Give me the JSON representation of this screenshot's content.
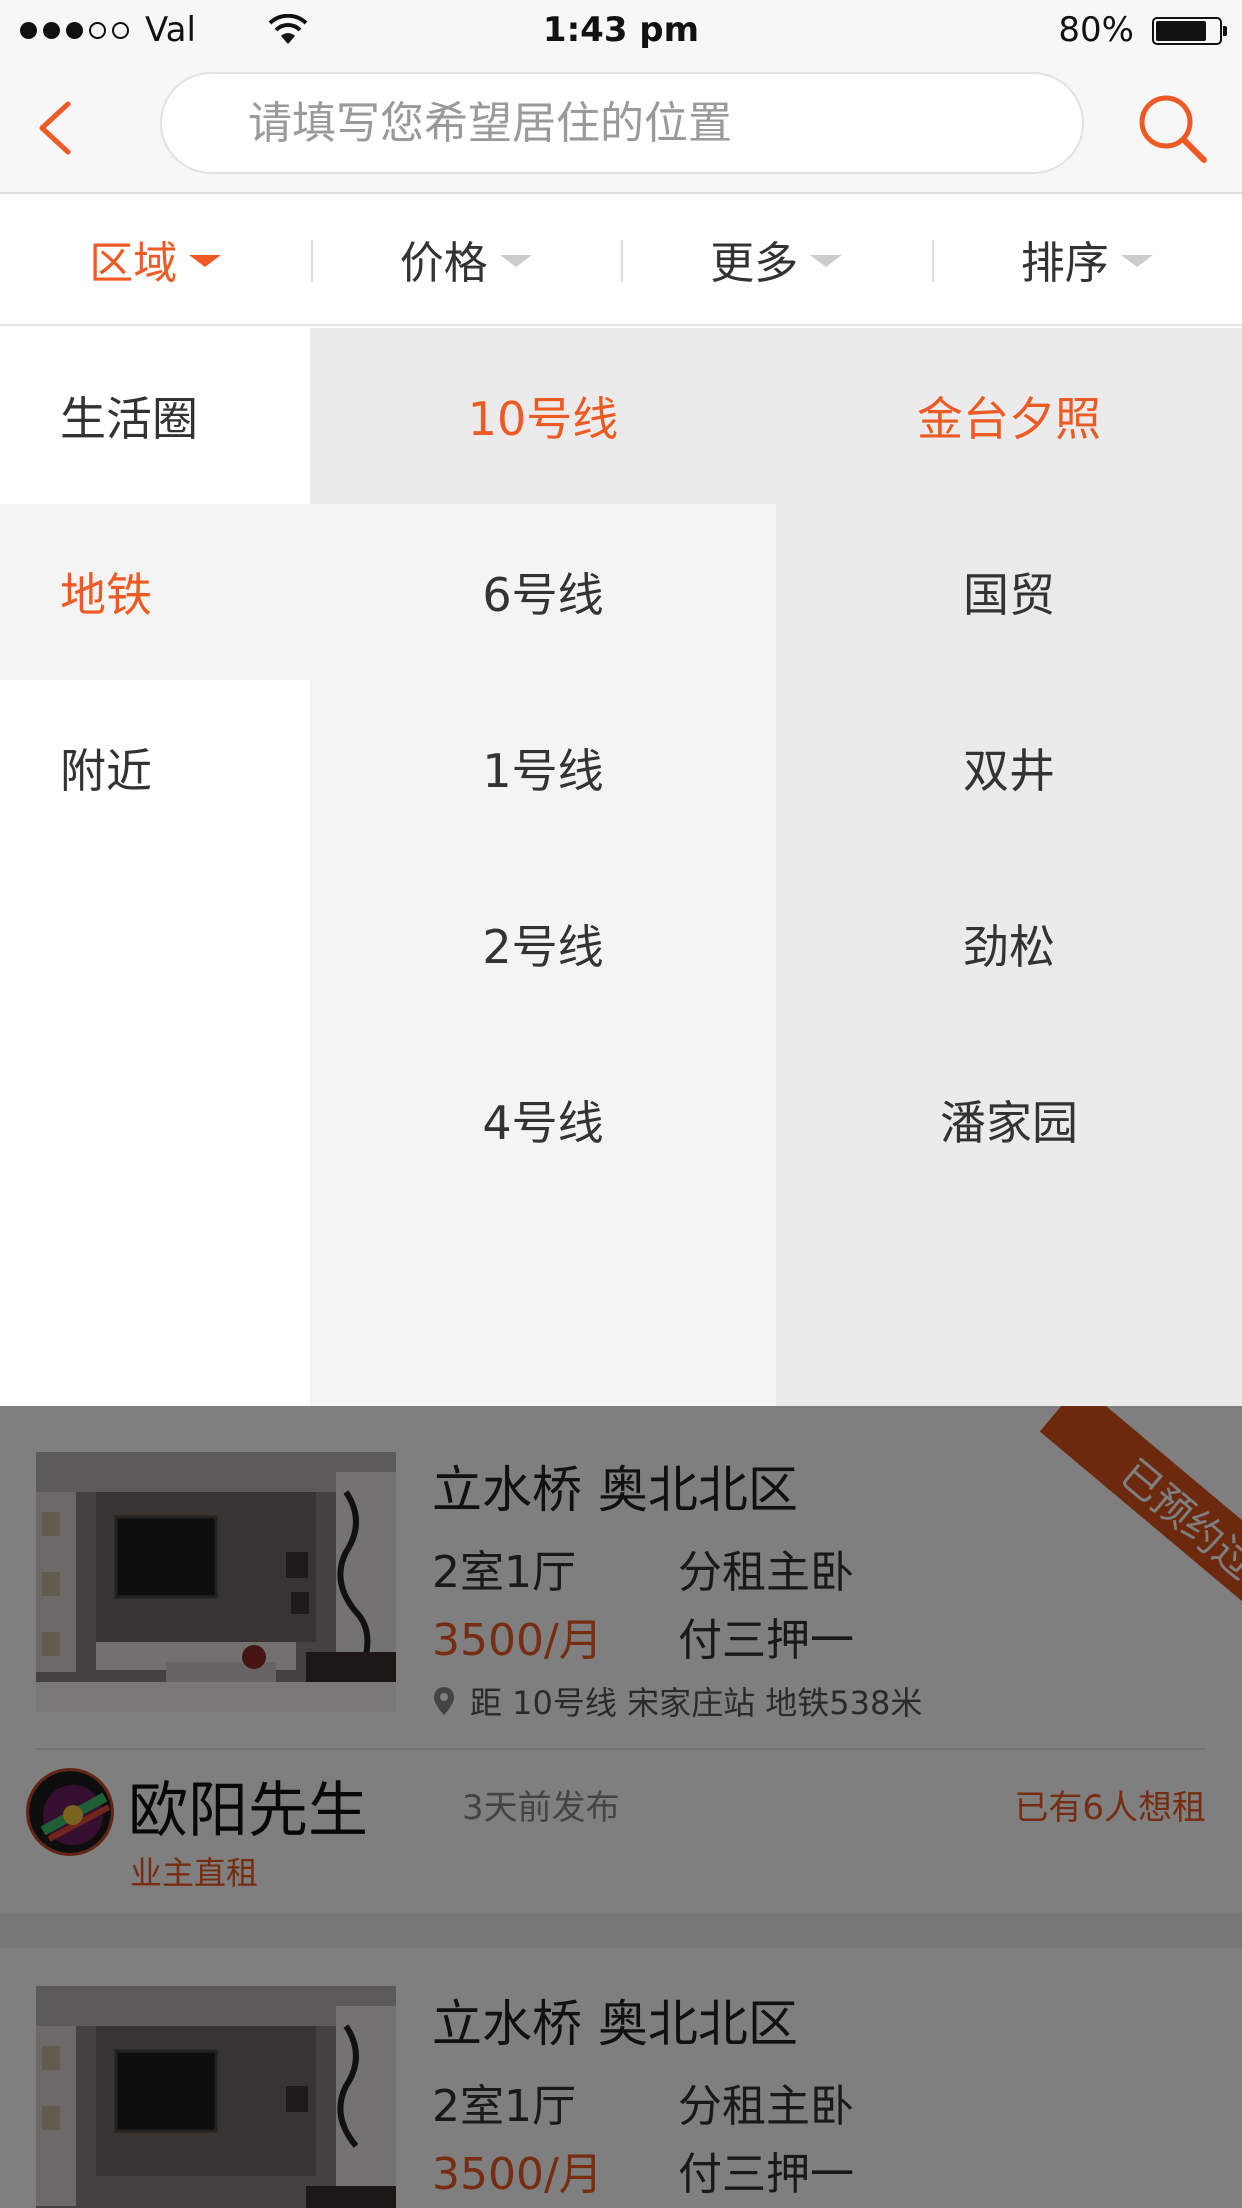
{
  "status_bar": {
    "carrier": "Val",
    "time": "1:43 pm",
    "battery": "80%",
    "battery_level": 0.8
  },
  "nav": {
    "back_icon": "chevron-left-icon",
    "search_placeholder": "请填写您希望居住的位置",
    "search_icon": "search-icon"
  },
  "filters": [
    {
      "label": "区域",
      "active": true
    },
    {
      "label": "价格",
      "active": false
    },
    {
      "label": "更多",
      "active": false
    },
    {
      "label": "排序",
      "active": false
    }
  ],
  "dropdown": {
    "categories": [
      {
        "label": "生活圈",
        "selected": false
      },
      {
        "label": "地铁",
        "selected": true
      },
      {
        "label": "附近",
        "selected": false
      }
    ],
    "lines": [
      {
        "label": "10号线",
        "selected": true
      },
      {
        "label": "6号线",
        "selected": false
      },
      {
        "label": "1号线",
        "selected": false
      },
      {
        "label": "2号线",
        "selected": false
      },
      {
        "label": "4号线",
        "selected": false
      }
    ],
    "stations": [
      {
        "label": "金台夕照",
        "selected": true
      },
      {
        "label": "国贸",
        "selected": false
      },
      {
        "label": "双井",
        "selected": false
      },
      {
        "label": "劲松",
        "selected": false
      },
      {
        "label": "潘家园",
        "selected": false
      }
    ]
  },
  "listings": [
    {
      "title": "立水桥  奥北北区",
      "layout": "2室1厅",
      "rent_type": "分租主卧",
      "price": "3500/月",
      "payment": "付三押一",
      "location": "距 10号线 宋家庄站 地铁538米",
      "owner": "欧阳先生",
      "owner_type": "业主直租",
      "posted": "3天前发布",
      "wanted": "已有6人想租",
      "ribbon": "已预约过"
    },
    {
      "title": "立水桥  奥北北区",
      "layout": "2室1厅",
      "rent_type": "分租主卧",
      "price": "3500/月",
      "payment": "付三押一"
    }
  ],
  "colors": {
    "accent": "#ee5a24",
    "overlay": "rgba(0,0,0,0.5)"
  }
}
